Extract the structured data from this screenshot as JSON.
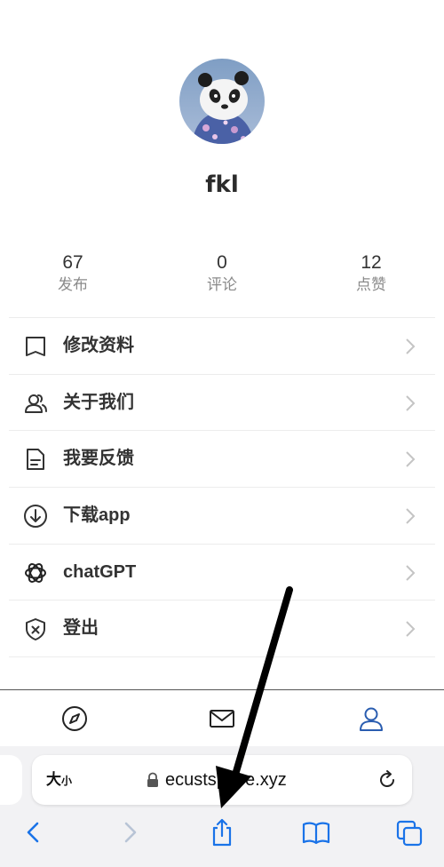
{
  "profile": {
    "username": "fkl"
  },
  "stats": [
    {
      "value": "67",
      "label": "发布"
    },
    {
      "value": "0",
      "label": "评论"
    },
    {
      "value": "12",
      "label": "点赞"
    }
  ],
  "menu": [
    {
      "label": "修改资料",
      "icon": "book-icon"
    },
    {
      "label": "关于我们",
      "icon": "users-icon"
    },
    {
      "label": "我要反馈",
      "icon": "document-icon"
    },
    {
      "label": "下载app",
      "icon": "download-icon"
    },
    {
      "label": "chatGPT",
      "icon": "openai-icon"
    },
    {
      "label": "登出",
      "icon": "shield-x-icon"
    }
  ],
  "tabbar": {
    "icons": [
      "compass-icon",
      "mail-icon",
      "user-icon"
    ],
    "active": "user-icon",
    "active_color": "#2a5db0"
  },
  "browser": {
    "size_button_big": "大",
    "size_button_small": "小",
    "url": "ecustspace.xyz",
    "accent_color": "#1a73e8"
  }
}
